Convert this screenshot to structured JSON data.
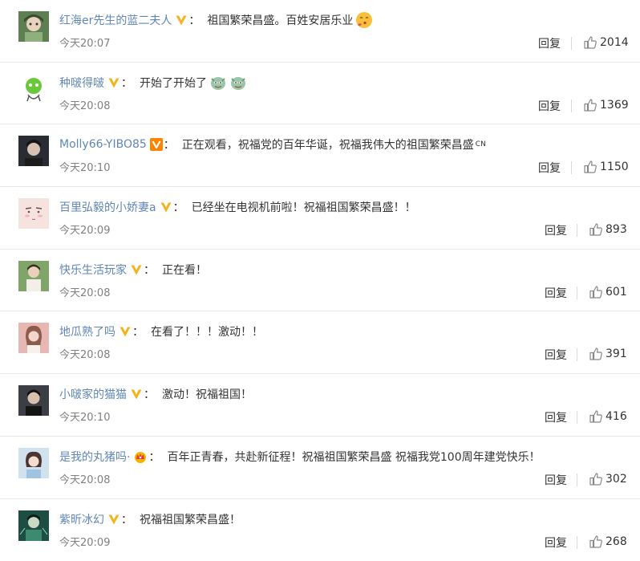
{
  "reply_label": "回复",
  "colon": "：",
  "comments": [
    {
      "user": "红海er先生的蓝二夫人",
      "badge": "vip-gold-v",
      "text": "祖国繁荣昌盛。百姓安居乐业",
      "emojis": [
        "kiss-emoji-icon"
      ],
      "time": "今天20:07",
      "likes": "2014"
    },
    {
      "user": "种啵得啵",
      "badge": "vip-gold-v",
      "text": "开始了开始了",
      "emojis": [
        "doge-emoji-icon",
        "doge-emoji-icon"
      ],
      "time": "今天20:08",
      "likes": "1369"
    },
    {
      "user": "Molly66-YIBO85",
      "badge": "vip-orange-v",
      "text": "正在观看，祝福党的百年华诞，祝福我伟大的祖国繁荣昌盛",
      "suffix": "CN",
      "emojis": [],
      "time": "今天20:10",
      "likes": "1150"
    },
    {
      "user": "百里弘毅的小娇妻a",
      "badge": "vip-gold-v",
      "text": "已经坐在电视机前啦！祝福祖国繁荣昌盛！！",
      "emojis": [],
      "time": "今天20:09",
      "likes": "893"
    },
    {
      "user": "快乐生活玩家",
      "badge": "vip-gold-v",
      "text": "正在看！",
      "emojis": [],
      "time": "今天20:08",
      "likes": "601"
    },
    {
      "user": "地瓜熟了吗",
      "badge": "vip-gold-v",
      "text": "在看了！！！激动！！",
      "emojis": [],
      "time": "今天20:08",
      "likes": "391"
    },
    {
      "user": "小啵家的猫猫",
      "badge": "vip-gold-v",
      "text": "激动！祝福祖国！",
      "emojis": [],
      "time": "今天20:10",
      "likes": "416"
    },
    {
      "user": "是我的丸猪吗·",
      "badge": "crown-badge",
      "text": "百年正青春，共赴新征程！祝福祖国繁荣昌盛 祝福我党100周年建党快乐！",
      "emojis": [],
      "time": "今天20:08",
      "likes": "302"
    },
    {
      "user": "紫昕冰幻",
      "badge": "vip-gold-v",
      "text": "祝福祖国繁荣昌盛！",
      "emojis": [],
      "time": "今天20:09",
      "likes": "268"
    }
  ],
  "colors": {
    "username": "#5f86b7",
    "vip_gold": "#f6b21b",
    "vip_orange": "#ff8200",
    "time": "#808080",
    "divider": "#e6e6e6"
  }
}
